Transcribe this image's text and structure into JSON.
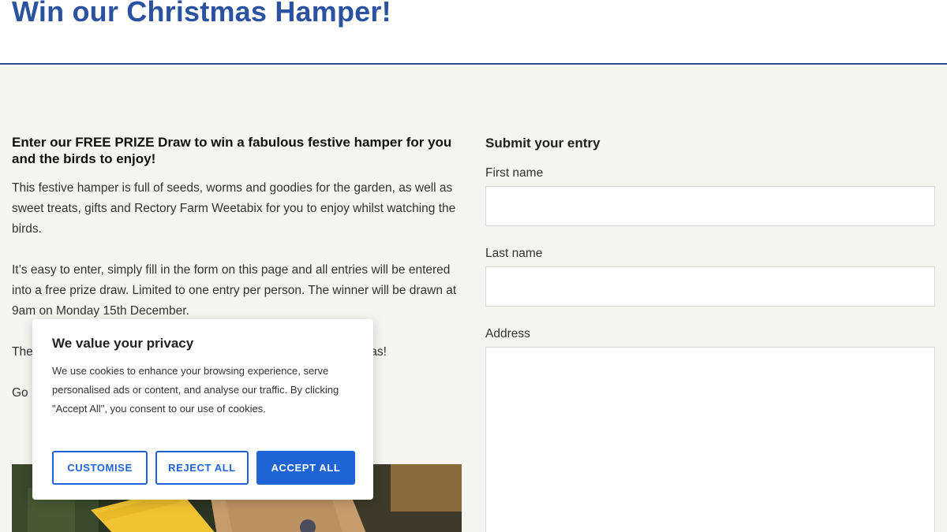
{
  "header": {
    "title": "Win our Christmas Hamper!"
  },
  "intro": {
    "heading": "Enter our FREE PRIZE Draw to win a fabulous festive hamper for you and the birds to enjoy!",
    "para1": "This festive hamper is full of seeds, worms and goodies for the garden, as well as sweet treats, gifts and Rectory Farm Weetabix for you to enjoy whilst watching the birds.",
    "para2": "It’s easy to enter, simply fill in the form on this page and all entries will be entered into a free prize draw. Limited to one entry per person. The winner will be drawn at 9am on Monday 15th December.",
    "para3": "The",
    "para3_tail": "tmas!",
    "para4": "Go"
  },
  "form": {
    "heading": "Submit your entry",
    "first_name_label": "First name",
    "last_name_label": "Last name",
    "address_label": "Address"
  },
  "cookie": {
    "title": "We value your privacy",
    "text": "We use cookies to enhance your browsing experience, serve personalised ads or content, and analyse our traffic. By clicking \"Accept All\", you consent to our use of cookies.",
    "customise": "CUSTOMISE",
    "reject": "REJECT ALL",
    "accept": "ACCEPT ALL"
  },
  "image": {
    "alt": "Hamper with Homegrown Wheat box and bird seed bag"
  },
  "colors": {
    "brand": "#2b52a0",
    "accent": "#1f63d6",
    "background": "#f4f5f0"
  }
}
